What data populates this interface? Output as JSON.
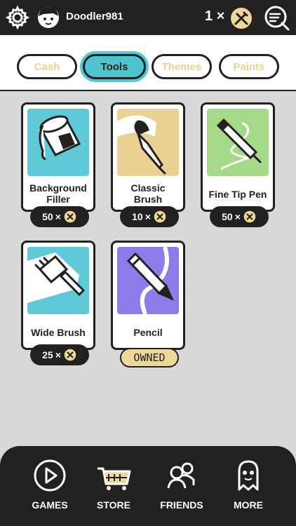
{
  "header": {
    "username": "Doodler981",
    "coin_count": "1",
    "times": "×"
  },
  "tabs": [
    {
      "label": "Cash",
      "active": false
    },
    {
      "label": "Tools",
      "active": true
    },
    {
      "label": "Themes",
      "active": false
    },
    {
      "label": "Paints",
      "active": false
    }
  ],
  "items": [
    {
      "name_line1": "Background",
      "name_line2": "Filler",
      "price": "50",
      "times": "×",
      "thumb_color": "#5fc9d8"
    },
    {
      "name_line1": "Classic",
      "name_line2": "Brush",
      "price": "10",
      "times": "×",
      "thumb_color": "#e8d193"
    },
    {
      "name_line1": "Fine Tip Pen",
      "price": "50",
      "times": "×",
      "thumb_color": "#a5d98a"
    },
    {
      "name_line1": "Wide Brush",
      "price": "25",
      "times": "×",
      "thumb_color": "#5fc9d8"
    },
    {
      "name_line1": "Pencil",
      "status": "OWNED",
      "thumb_color": "#8c7be8"
    }
  ],
  "nav": [
    {
      "label": "GAMES",
      "icon": "play-icon"
    },
    {
      "label": "STORE",
      "icon": "cart-icon"
    },
    {
      "label": "FRIENDS",
      "icon": "friends-icon"
    },
    {
      "label": "MORE",
      "icon": "ghost-icon"
    }
  ],
  "colors": {
    "dark": "#232020",
    "accent_teal": "#4fc4cf",
    "coin_gold": "#ecd897",
    "inactive_tab_text": "#e8d38c"
  }
}
